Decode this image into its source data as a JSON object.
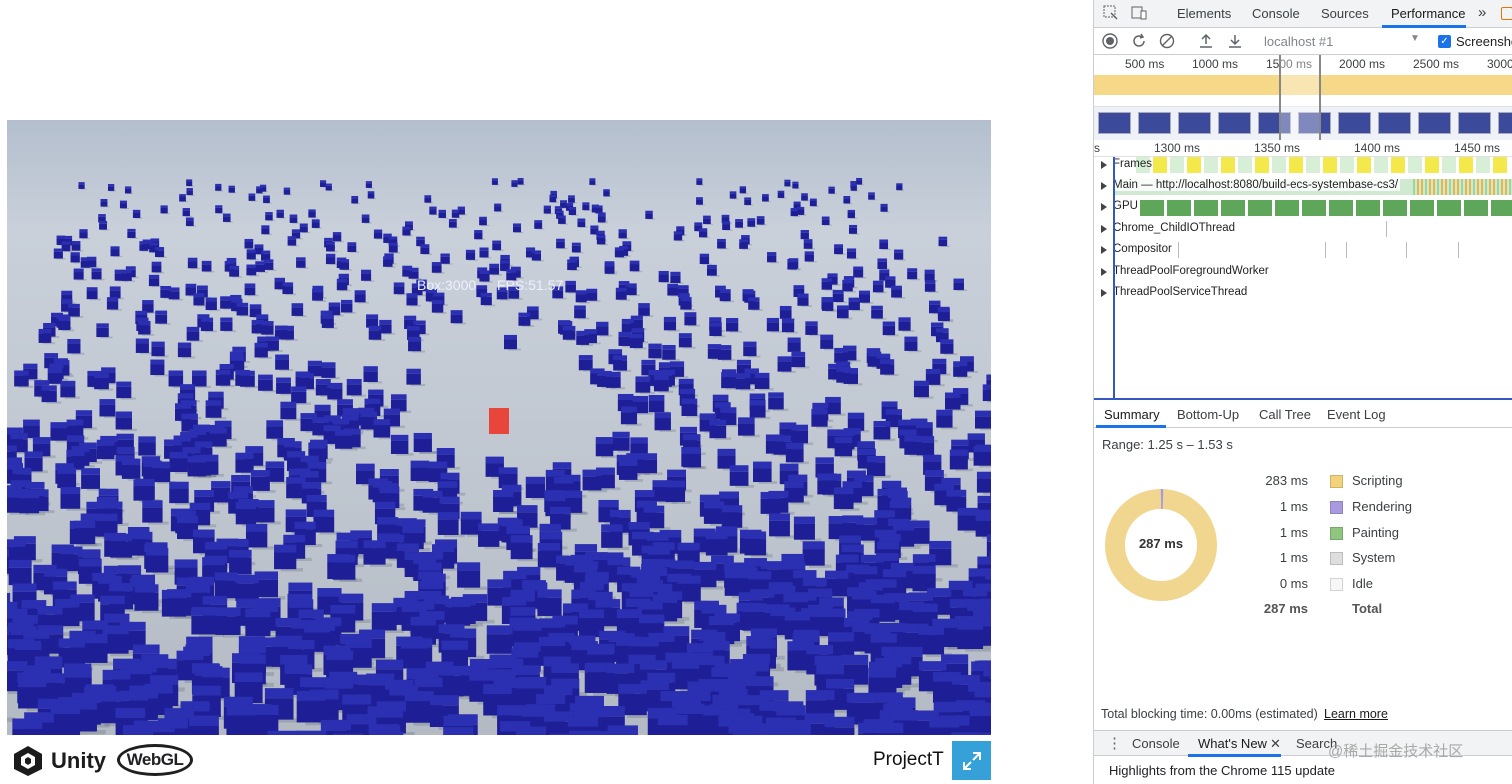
{
  "game": {
    "stats_box": "Box:3000",
    "stats_fps": "FPS:51.57",
    "unity_brand": "Unity",
    "webgl_brand": "WebGL",
    "project_title": "ProjectT"
  },
  "devtools": {
    "tabs": [
      "Elements",
      "Console",
      "Sources",
      "Performance"
    ],
    "more_tabs": "»",
    "toolbar": {
      "target": "localhost #1",
      "screenshots_label": "Screenshots",
      "screenshots_checked": true
    },
    "overview_ticks": [
      "500 ms",
      "1000 ms",
      "1500 ms",
      "2000 ms",
      "2500 ms",
      "3000"
    ],
    "detail_ticks": [
      "s",
      "1300 ms",
      "1350 ms",
      "1400 ms",
      "1450 ms"
    ],
    "tracks": [
      "Frames",
      "Main — http://localhost:8080/build-ecs-systembase-cs3/",
      "GPU",
      "Chrome_ChildIOThread",
      "Compositor",
      "ThreadPoolForegroundWorker",
      "ThreadPoolServiceThread"
    ],
    "summary_tabs": [
      "Summary",
      "Bottom-Up",
      "Call Tree",
      "Event Log"
    ],
    "range": "Range: 1.25 s – 1.53 s",
    "donut_total": "287 ms",
    "breakdown": [
      {
        "value": "283 ms",
        "name": "Scripting",
        "color": "#f2d27b"
      },
      {
        "value": "1 ms",
        "name": "Rendering",
        "color": "#a99ae0"
      },
      {
        "value": "1 ms",
        "name": "Painting",
        "color": "#8fc57e"
      },
      {
        "value": "1 ms",
        "name": "System",
        "color": "#dedede"
      },
      {
        "value": "0 ms",
        "name": "Idle",
        "color": "#f7f7f7"
      }
    ],
    "total_value": "287 ms",
    "total_label": "Total",
    "tbt_text": "Total blocking time: 0.00ms (estimated)",
    "learn_more": "Learn more",
    "drawer_tabs": [
      "Console",
      "What's New",
      "Search"
    ],
    "drawer_highlights": "Highlights from the Chrome 115 update"
  },
  "watermark": "@稀土掘金技术社区"
}
